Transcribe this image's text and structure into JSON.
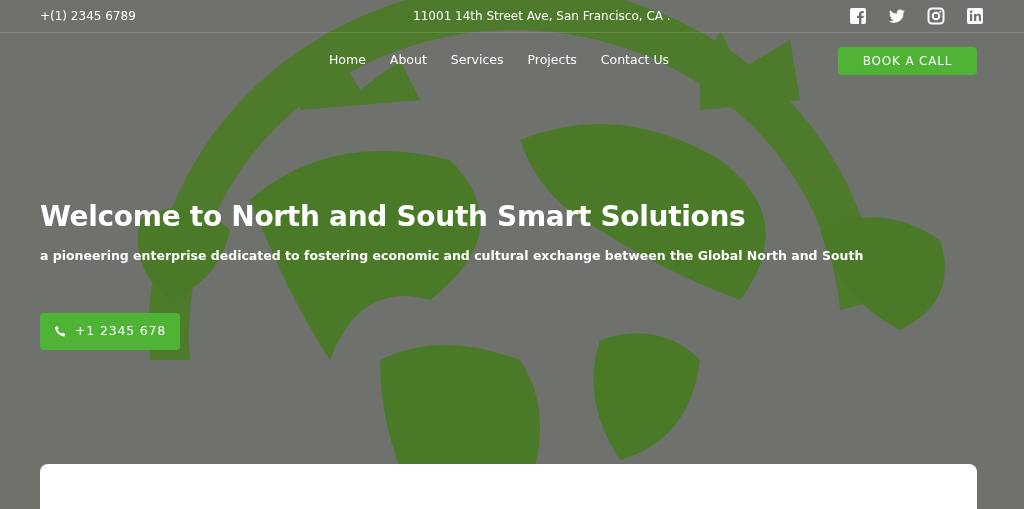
{
  "top_bar": {
    "phone": "+(1) 2345 6789",
    "address": "11001 14th Street Ave, San Francisco, CA .",
    "social": [
      {
        "kind": "facebook"
      },
      {
        "kind": "twitter"
      },
      {
        "kind": "instagram"
      },
      {
        "kind": "linkedin"
      }
    ]
  },
  "nav": {
    "links": [
      "Home",
      "About",
      "Services",
      "Projects",
      "Contact Us"
    ],
    "cta": "BOOK A CALL"
  },
  "hero": {
    "title": "Welcome to North and South Smart Solutions",
    "subtitle": "a pioneering enterprise dedicated to fostering economic and cultural exchange between the Global North and South",
    "button": "+1 2345 678"
  }
}
